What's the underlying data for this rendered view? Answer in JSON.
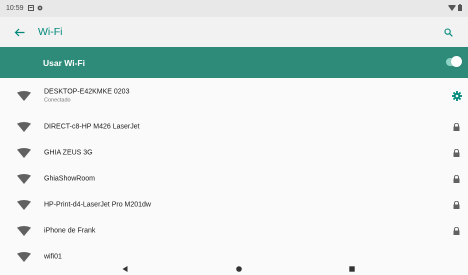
{
  "status_bar": {
    "time": "10:59"
  },
  "app_bar": {
    "title": "Wi-Fi"
  },
  "master_switch": {
    "label": "Usar Wi-Fi",
    "enabled": true
  },
  "networks": [
    {
      "ssid": "DESKTOP-E42KMKE 0203",
      "status": "Conectado",
      "connected": true,
      "locked": false
    },
    {
      "ssid": "DIRECT-c8-HP M426 LaserJet",
      "status": "",
      "connected": false,
      "locked": true
    },
    {
      "ssid": "GHIA ZEUS 3G",
      "status": "",
      "connected": false,
      "locked": true
    },
    {
      "ssid": "GhiaShowRoom",
      "status": "",
      "connected": false,
      "locked": true
    },
    {
      "ssid": "HP-Print-d4-LaserJet Pro M201dw",
      "status": "",
      "connected": false,
      "locked": true
    },
    {
      "ssid": "iPhone de Frank",
      "status": "",
      "connected": false,
      "locked": true
    },
    {
      "ssid": "wifi01",
      "status": "",
      "connected": false,
      "locked": false
    }
  ],
  "colors": {
    "accent": "#00897b",
    "master_bar": "#2e8b7a",
    "icon_gray": "#616161"
  }
}
